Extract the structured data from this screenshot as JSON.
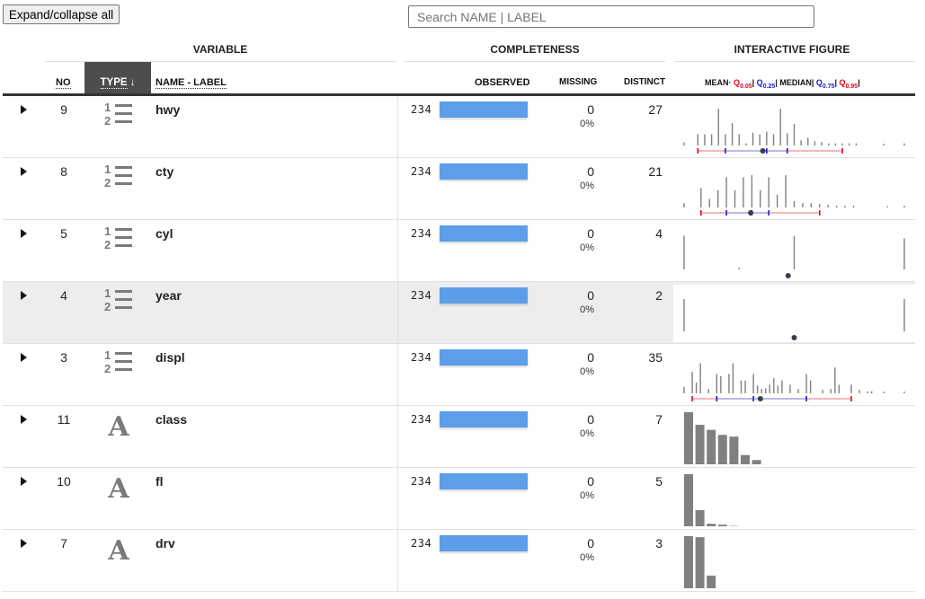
{
  "toolbar": {
    "expand_label": "Expand/collapse all"
  },
  "search": {
    "placeholder": "Search NAME | LABEL",
    "value": ""
  },
  "groups": {
    "variable": "VARIABLE",
    "completeness": "COMPLETENESS",
    "figure": "INTERACTIVE FIGURE"
  },
  "columns": {
    "no": "NO",
    "type": "TYPE",
    "sort_arrow": "↓",
    "name": "NAME - LABEL",
    "observed": "OBSERVED",
    "missing": "MISSING",
    "distinct": "DISTINCT"
  },
  "legend": {
    "mean": "MEAN",
    "q05": "Q",
    "q05_sub": "0.05",
    "q25": "Q",
    "q25_sub": "0.25",
    "median": "MEDIAN",
    "q75": "Q",
    "q75_sub": "0.75",
    "q95": "Q",
    "q95_sub": "0.95"
  },
  "colors": {
    "bar": "#5c9ee8",
    "spike": "#808080",
    "q_outer": "#e8001c",
    "q_inner": "#1a1ad6",
    "type_header_bg": "#4d4d4d"
  },
  "rows": [
    {
      "no": "9",
      "type_icon": "numeric-icon",
      "name": "hwy",
      "observed": "234",
      "observed_fraction": 1.0,
      "missing": "0",
      "missing_pct": "0%",
      "distinct": "27",
      "figure": {
        "kind": "spikes",
        "range": [
          12,
          44
        ],
        "spikes": [
          [
            12,
            0.07
          ],
          [
            14,
            0.26
          ],
          [
            15,
            0.26
          ],
          [
            16,
            0.26
          ],
          [
            17,
            0.85
          ],
          [
            18,
            0.26
          ],
          [
            19,
            0.52
          ],
          [
            20,
            0.26
          ],
          [
            21,
            0.05
          ],
          [
            22,
            0.3
          ],
          [
            23,
            0.26
          ],
          [
            24,
            0.32
          ],
          [
            25,
            0.26
          ],
          [
            26,
            0.85
          ],
          [
            27,
            0.28
          ],
          [
            28,
            0.5
          ],
          [
            29,
            0.12
          ],
          [
            30,
            0.18
          ],
          [
            31,
            0.1
          ],
          [
            32,
            0.08
          ],
          [
            33,
            0.05
          ],
          [
            34,
            0.05
          ],
          [
            35,
            0.05
          ],
          [
            36,
            0.05
          ],
          [
            37,
            0.05
          ],
          [
            41,
            0.04
          ],
          [
            44,
            0.05
          ]
        ],
        "q05": 14,
        "q25": 18,
        "median": 24,
        "q75": 27,
        "q95": 35,
        "mean": 23.44
      }
    },
    {
      "no": "8",
      "type_icon": "numeric-icon",
      "name": "cty",
      "observed": "234",
      "observed_fraction": 1.0,
      "missing": "0",
      "missing_pct": "0%",
      "distinct": "21",
      "figure": {
        "kind": "spikes",
        "range": [
          9,
          35
        ],
        "spikes": [
          [
            9,
            0.1
          ],
          [
            11,
            0.45
          ],
          [
            12,
            0.2
          ],
          [
            13,
            0.4
          ],
          [
            14,
            0.7
          ],
          [
            15,
            0.4
          ],
          [
            16,
            0.7
          ],
          [
            17,
            0.75
          ],
          [
            18,
            0.4
          ],
          [
            19,
            0.7
          ],
          [
            20,
            0.3
          ],
          [
            21,
            0.75
          ],
          [
            22,
            0.15
          ],
          [
            23,
            0.1
          ],
          [
            24,
            0.1
          ],
          [
            25,
            0.08
          ],
          [
            26,
            0.06
          ],
          [
            27,
            0.04
          ],
          [
            28,
            0.04
          ],
          [
            29,
            0.04
          ],
          [
            33,
            0.03
          ],
          [
            35,
            0.04
          ]
        ],
        "q05": 11,
        "q25": 14,
        "median": 17,
        "q75": 19,
        "q95": 25,
        "mean": 16.86
      }
    },
    {
      "no": "5",
      "type_icon": "numeric-icon",
      "name": "cyl",
      "observed": "234",
      "observed_fraction": 1.0,
      "missing": "0",
      "missing_pct": "0%",
      "distinct": "4",
      "figure": {
        "kind": "spikes",
        "range": [
          4,
          8
        ],
        "spikes": [
          [
            4,
            0.78
          ],
          [
            5,
            0.04
          ],
          [
            6,
            0.78
          ],
          [
            8,
            0.72
          ]
        ],
        "mean": 5.89
      }
    },
    {
      "no": "4",
      "type_icon": "numeric-icon",
      "name": "year",
      "observed": "234",
      "observed_fraction": 1.0,
      "missing": "0",
      "missing_pct": "0%",
      "distinct": "2",
      "figure": {
        "kind": "spikes",
        "range": [
          1999,
          2008
        ],
        "spikes": [
          [
            1999,
            0.75
          ],
          [
            2008,
            0.75
          ]
        ],
        "mean": 2003.5
      }
    },
    {
      "no": "3",
      "type_icon": "numeric-icon",
      "name": "displ",
      "observed": "234",
      "observed_fraction": 1.0,
      "missing": "0",
      "missing_pct": "0%",
      "distinct": "35",
      "figure": {
        "kind": "spikes",
        "range": [
          1.6,
          7.0
        ],
        "spikes": [
          [
            1.6,
            0.15
          ],
          [
            1.8,
            0.5
          ],
          [
            1.9,
            0.25
          ],
          [
            2.0,
            0.7
          ],
          [
            2.2,
            0.1
          ],
          [
            2.4,
            0.45
          ],
          [
            2.5,
            0.4
          ],
          [
            2.7,
            0.45
          ],
          [
            2.8,
            0.7
          ],
          [
            3.0,
            0.3
          ],
          [
            3.1,
            0.3
          ],
          [
            3.3,
            0.45
          ],
          [
            3.4,
            0.18
          ],
          [
            3.5,
            0.1
          ],
          [
            3.6,
            0.12
          ],
          [
            3.7,
            0.2
          ],
          [
            3.8,
            0.35
          ],
          [
            3.9,
            0.18
          ],
          [
            4.0,
            0.3
          ],
          [
            4.2,
            0.2
          ],
          [
            4.4,
            0.1
          ],
          [
            4.6,
            0.45
          ],
          [
            4.7,
            0.3
          ],
          [
            5.0,
            0.08
          ],
          [
            5.2,
            0.1
          ],
          [
            5.3,
            0.6
          ],
          [
            5.4,
            0.2
          ],
          [
            5.7,
            0.2
          ],
          [
            5.9,
            0.08
          ],
          [
            6.1,
            0.05
          ],
          [
            6.2,
            0.05
          ],
          [
            6.5,
            0.04
          ],
          [
            7.0,
            0.04
          ]
        ],
        "q05": 1.8,
        "q25": 2.4,
        "median": 3.3,
        "q75": 4.6,
        "q95": 5.7,
        "mean": 3.47
      }
    },
    {
      "no": "11",
      "type_icon": "text-icon",
      "name": "class",
      "observed": "234",
      "observed_fraction": 1.0,
      "missing": "0",
      "missing_pct": "0%",
      "distinct": "7",
      "figure": {
        "kind": "bars",
        "bars": [
          62,
          47,
          41,
          35,
          33,
          11,
          5
        ]
      }
    },
    {
      "no": "10",
      "type_icon": "text-icon",
      "name": "fl",
      "observed": "234",
      "observed_fraction": 1.0,
      "missing": "0",
      "missing_pct": "0%",
      "distinct": "5",
      "figure": {
        "kind": "bars",
        "bars": [
          168,
          52,
          8,
          5,
          1
        ]
      }
    },
    {
      "no": "7",
      "type_icon": "text-icon",
      "name": "drv",
      "observed": "234",
      "observed_fraction": 1.0,
      "missing": "0",
      "missing_pct": "0%",
      "distinct": "3",
      "figure": {
        "kind": "bars",
        "bars": [
          103,
          101,
          25
        ]
      }
    }
  ]
}
